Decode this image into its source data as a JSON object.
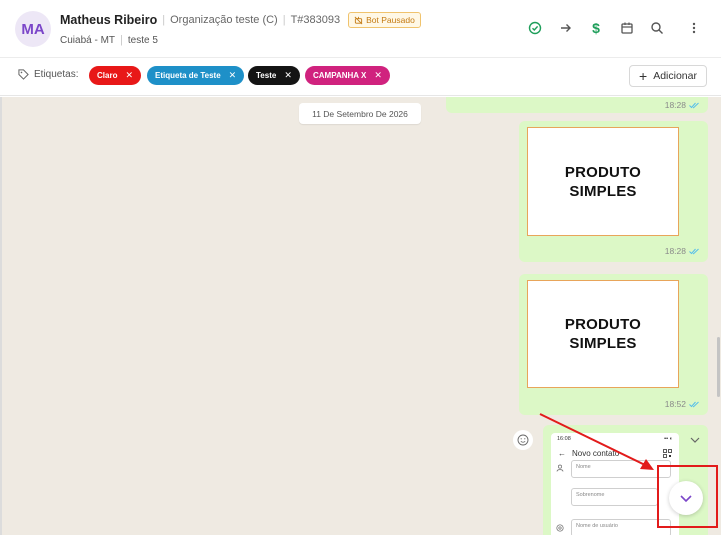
{
  "contact": {
    "avatar_initials": "MA",
    "name": "Matheus Ribeiro",
    "organization": "Organização teste (C)",
    "ticket": "T#383093",
    "bot_status": "Bot Pausado",
    "location": "Cuiabá - MT",
    "queue": "teste 5"
  },
  "header_actions": [
    {
      "name": "resolve-ticket",
      "icon": "check-circle-icon",
      "color": "#1e9e5a"
    },
    {
      "name": "transfer-ticket",
      "icon": "arrow-right-icon",
      "color": "#555555"
    },
    {
      "name": "payment",
      "icon": "dollar-icon",
      "color": "#1e9e5a"
    },
    {
      "name": "schedule",
      "icon": "calendar-icon",
      "color": "#555555"
    },
    {
      "name": "search-messages",
      "icon": "search-icon",
      "color": "#555555"
    },
    {
      "name": "more-options",
      "icon": "kebab-icon",
      "color": "#555555"
    }
  ],
  "tags": {
    "label": "Etiquetas:",
    "items": [
      {
        "label": "Claro",
        "color": "#e81818"
      },
      {
        "label": "Etiqueta de Teste",
        "color": "#1e90c8"
      },
      {
        "label": "Teste",
        "color": "#141414"
      },
      {
        "label": "CAMPANHA X",
        "color": "#d0227e"
      }
    ],
    "add_label": "Adicionar"
  },
  "chat": {
    "background": "#efeae2",
    "bubble_color": "#dcf8c6",
    "date_separator": "11 De Setembro De 2026",
    "messages": [
      {
        "type": "partial",
        "time": "18:28",
        "read": true
      },
      {
        "type": "image",
        "image_text_line1": "PRODUTO",
        "image_text_line2": "SIMPLES",
        "time": "18:28",
        "read": true
      },
      {
        "type": "image",
        "image_text_line1": "PRODUTO",
        "image_text_line2": "SIMPLES",
        "time": "18:52",
        "read": true
      }
    ],
    "screenshot_preview": {
      "status_time": "16:08",
      "status_icons": "▪▪ ◐",
      "title": "Novo contato",
      "fields": [
        "Nome",
        "Sobrenome",
        "Nome de usuário"
      ]
    }
  },
  "annotation_color": "#e21b1b"
}
